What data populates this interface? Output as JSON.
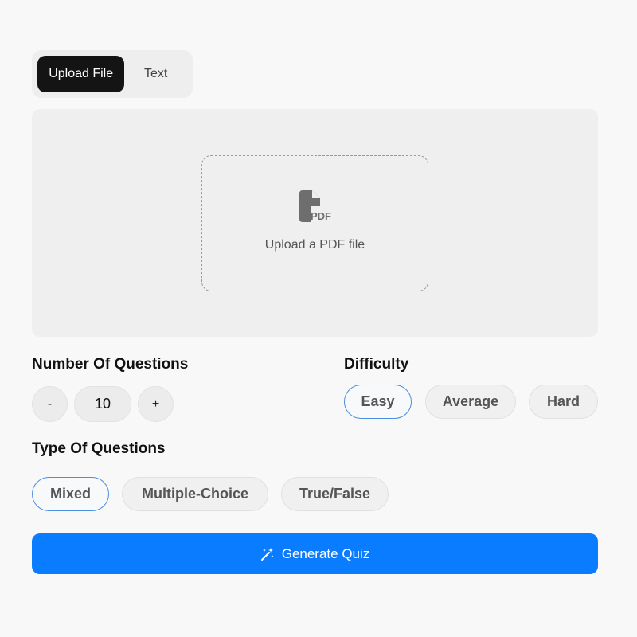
{
  "tabs": [
    {
      "label": "Upload File",
      "active": true
    },
    {
      "label": "Text",
      "active": false
    }
  ],
  "upload": {
    "icon": "pdf-file-icon",
    "icon_text": "PDF",
    "prompt": "Upload a PDF file"
  },
  "questions": {
    "heading": "Number Of Questions",
    "decrement_label": "-",
    "increment_label": "+",
    "count": "10"
  },
  "difficulty": {
    "heading": "Difficulty",
    "options": [
      "Easy",
      "Average",
      "Hard"
    ],
    "selected": "Easy"
  },
  "question_type": {
    "heading": "Type Of Questions",
    "options": [
      "Mixed",
      "Multiple-Choice",
      "True/False"
    ],
    "selected": "Mixed"
  },
  "generate": {
    "label": "Generate Quiz",
    "icon": "magic-wand-icon"
  },
  "colors": {
    "accent": "#0a7cff",
    "selected_border": "#4a8fe0",
    "active_tab": "#141414",
    "background": "#f7f8f7"
  }
}
